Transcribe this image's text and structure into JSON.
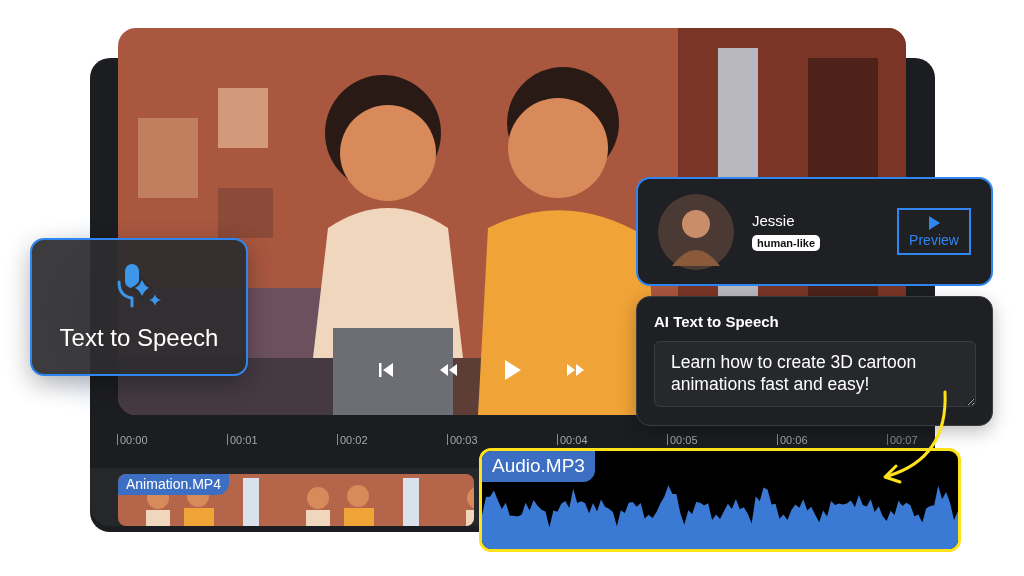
{
  "feature_card": {
    "label": "Text to Speech"
  },
  "voice_card": {
    "name": "Jessie",
    "tag": "human-like",
    "button": "Preview"
  },
  "tts_panel": {
    "title": "AI Text to Speech",
    "value": "Learn how to create 3D cartoon animations fast and easy!"
  },
  "timeline": {
    "ticks": [
      "00:00",
      "00:01",
      "00:02",
      "00:03",
      "00:04",
      "00:05",
      "00:06",
      "00:07"
    ]
  },
  "tracks": [
    {
      "kind": "video",
      "label": "Animation.MP4"
    },
    {
      "kind": "audio",
      "label": "Audio.MP3"
    }
  ]
}
